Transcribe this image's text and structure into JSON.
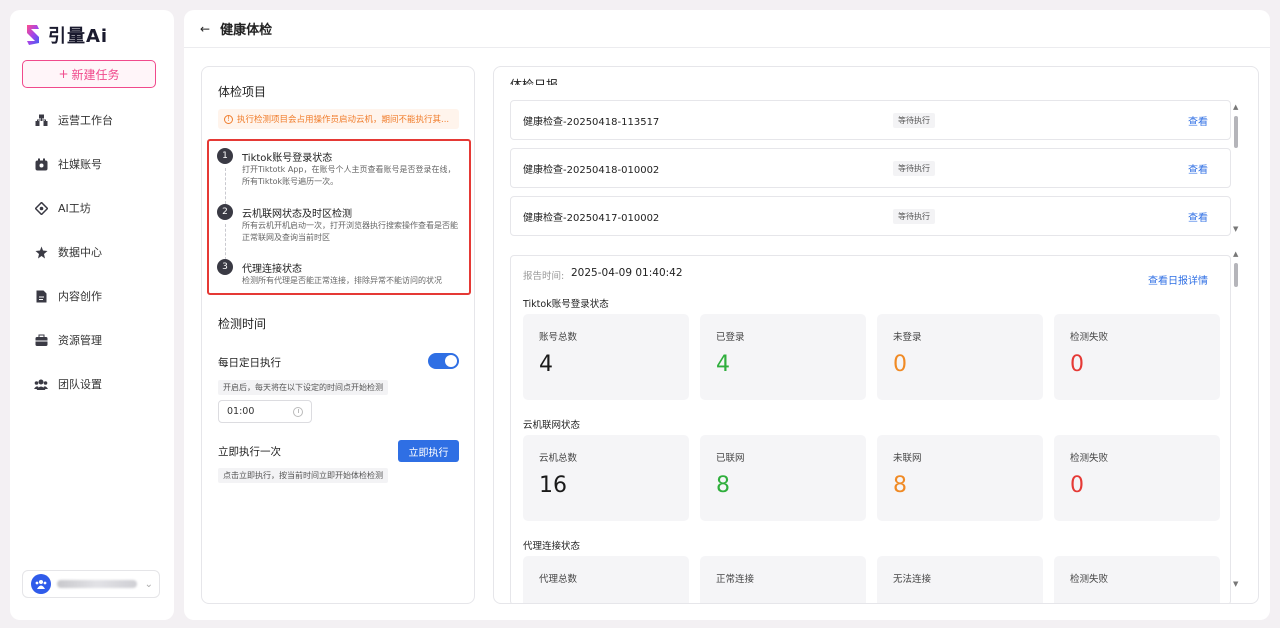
{
  "sidebar": {
    "logo_text": "引量Ai",
    "new_task_label": "新建任务",
    "items": [
      {
        "label": "运营工作台",
        "icon": "workbench-icon"
      },
      {
        "label": "社媒账号",
        "icon": "account-icon"
      },
      {
        "label": "AI工坊",
        "icon": "ai-workshop-icon"
      },
      {
        "label": "数据中心",
        "icon": "data-center-icon"
      },
      {
        "label": "内容创作",
        "icon": "content-icon"
      },
      {
        "label": "资源管理",
        "icon": "resource-icon"
      },
      {
        "label": "团队设置",
        "icon": "team-icon"
      }
    ]
  },
  "header": {
    "title": "健康体检"
  },
  "check_items": {
    "title": "体检项目",
    "warning": "执行检测项目会占用操作员启动云机，期间不能执行其...",
    "steps": [
      {
        "num": "1",
        "title": "Tiktok账号登录状态",
        "desc": "打开Tiktotk App，在账号个人主页查看账号是否登录在线，所有Tiktok账号遍历一次。"
      },
      {
        "num": "2",
        "title": "云机联网状态及时区检测",
        "desc": "所有云机开机启动一次，打开浏览器执行搜索操作查看是否能正常联网及查询当前时区"
      },
      {
        "num": "3",
        "title": "代理连接状态",
        "desc": "检测所有代理是否能正常连接，排除异常不能访问的状况"
      }
    ]
  },
  "schedule": {
    "title": "检测时间",
    "daily_label": "每日定日执行",
    "daily_enabled": true,
    "daily_hint": "开启后，每天将在以下设定的时间点开始检测",
    "time_value": "01:00",
    "run_now_label": "立即执行一次",
    "run_button": "立即执行",
    "run_hint": "点击立即执行，按当前时间立即开始体检检测"
  },
  "reports": {
    "title": "体检日报",
    "items": [
      {
        "name": "健康检查-20250418-113517",
        "status": "等待执行",
        "action": "查看"
      },
      {
        "name": "健康检查-20250418-010002",
        "status": "等待执行",
        "action": "查看"
      },
      {
        "name": "健康检查-20250417-010002",
        "status": "等待执行",
        "action": "查看"
      }
    ]
  },
  "report_detail": {
    "time_label": "报告时间:",
    "time_value": "2025-04-09 01:40:42",
    "detail_link": "查看日报详情",
    "groups": [
      {
        "title": "Tiktok账号登录状态",
        "stats": [
          {
            "label": "账号总数",
            "value": "4",
            "color": "#1a1a1a"
          },
          {
            "label": "已登录",
            "value": "4",
            "color": "#2fae3c"
          },
          {
            "label": "未登录",
            "value": "0",
            "color": "#f08a24"
          },
          {
            "label": "检测失败",
            "value": "0",
            "color": "#e53935"
          }
        ]
      },
      {
        "title": "云机联网状态",
        "stats": [
          {
            "label": "云机总数",
            "value": "16",
            "color": "#1a1a1a"
          },
          {
            "label": "已联网",
            "value": "8",
            "color": "#2fae3c"
          },
          {
            "label": "未联网",
            "value": "8",
            "color": "#f08a24"
          },
          {
            "label": "检测失败",
            "value": "0",
            "color": "#e53935"
          }
        ]
      },
      {
        "title": "代理连接状态",
        "stats": [
          {
            "label": "代理总数",
            "value": "",
            "color": "#1a1a1a"
          },
          {
            "label": "正常连接",
            "value": "",
            "color": "#2fae3c"
          },
          {
            "label": "无法连接",
            "value": "",
            "color": "#f08a24"
          },
          {
            "label": "检测失败",
            "value": "",
            "color": "#e53935"
          }
        ]
      }
    ]
  }
}
